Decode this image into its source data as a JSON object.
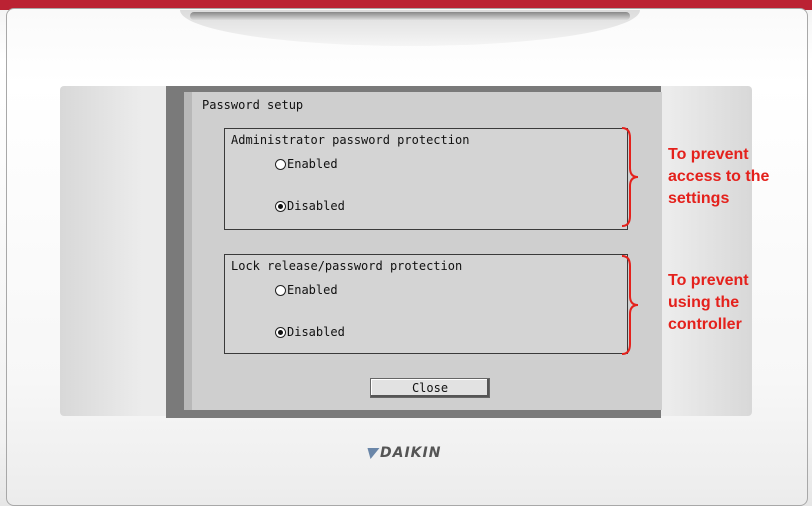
{
  "screen": {
    "title": "Password setup",
    "groups": [
      {
        "label": "Administrator password protection",
        "options": [
          "Enabled",
          "Disabled"
        ],
        "selected": "Disabled"
      },
      {
        "label": "Lock release/password protection",
        "options": [
          "Enabled",
          "Disabled"
        ],
        "selected": "Disabled"
      }
    ],
    "close_label": "Close"
  },
  "brand": {
    "logo_text": "DAIKIN"
  },
  "annotations": [
    "To prevent\naccess to the\nsettings",
    "To prevent\nusing  the\ncontroller"
  ],
  "colors": {
    "annotation": "#e4211c",
    "screen_bg": "#cfcfcf",
    "bezel": "#7a7a7a"
  }
}
